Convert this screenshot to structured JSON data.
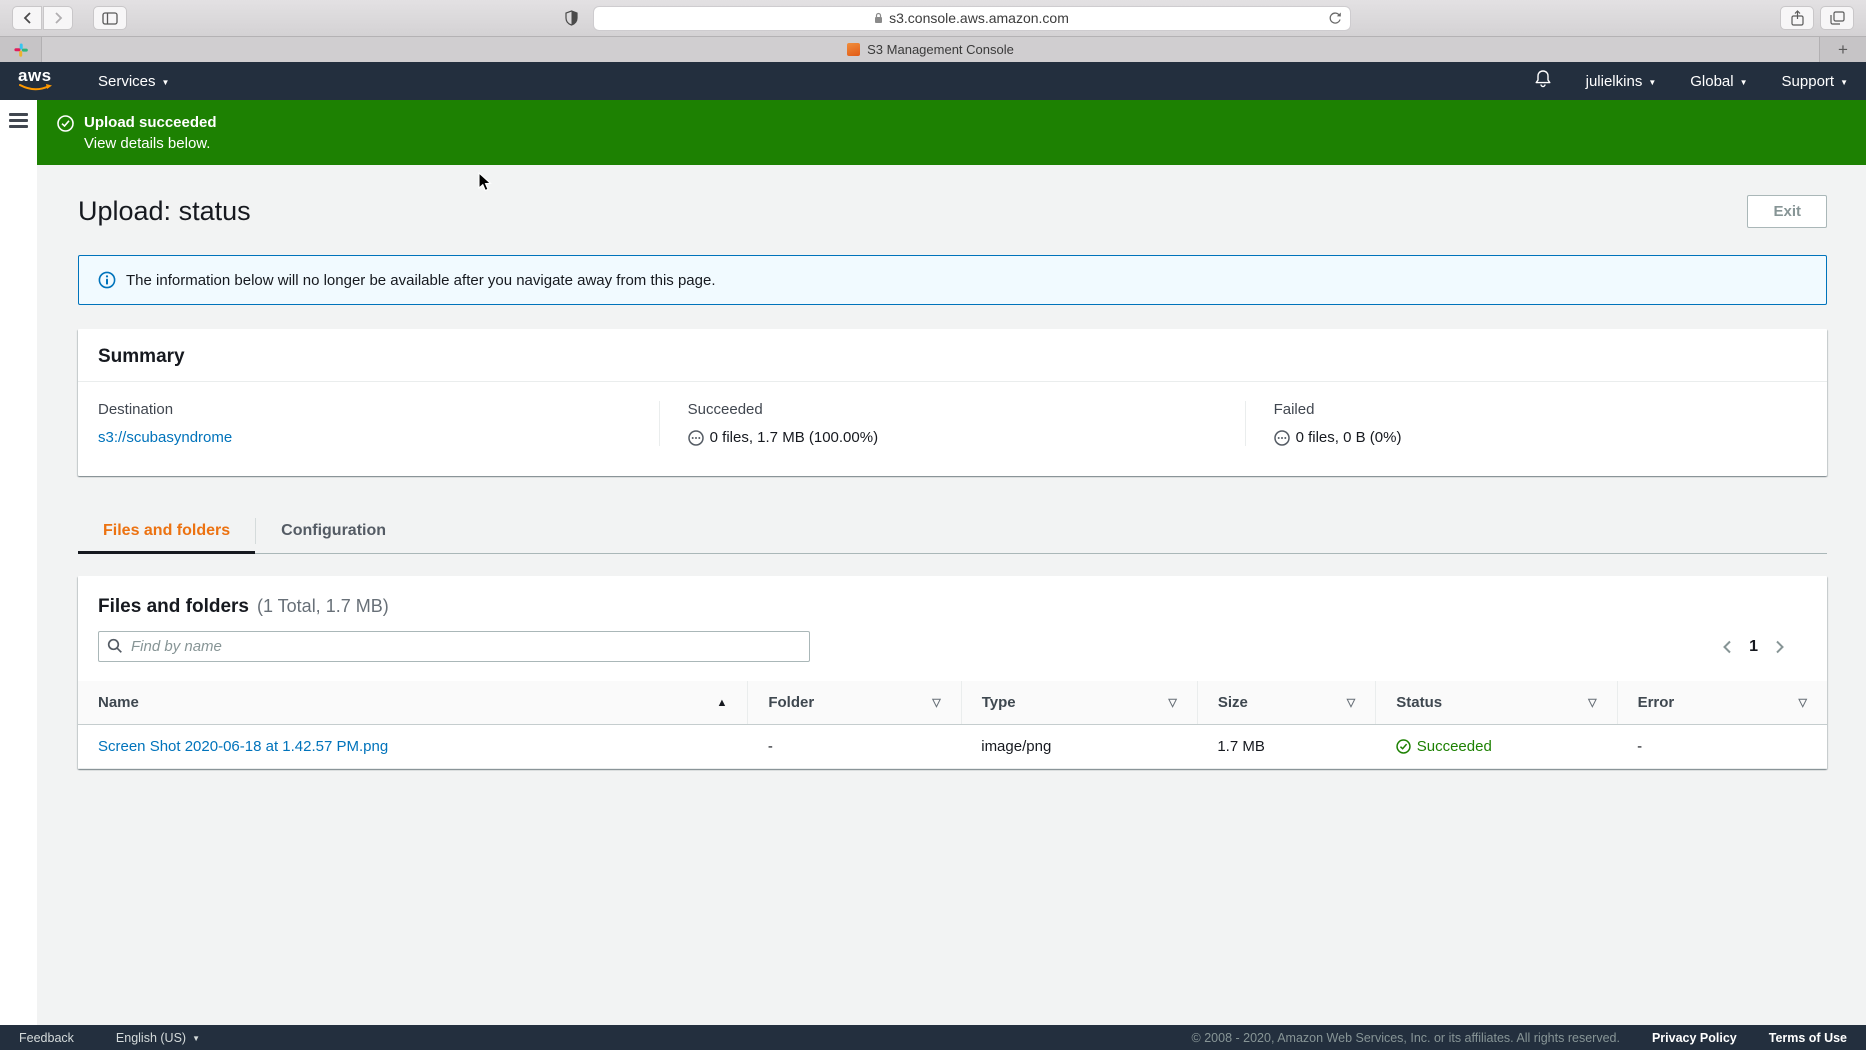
{
  "browser": {
    "url": "s3.console.aws.amazon.com",
    "tab_title": "S3 Management Console",
    "new_tab_label": "+"
  },
  "navbar": {
    "logo_text": "aws",
    "services_label": "Services",
    "username": "julielkins",
    "region_label": "Global",
    "support_label": "Support"
  },
  "banner": {
    "title": "Upload succeeded",
    "subtitle": "View details below."
  },
  "page": {
    "title": "Upload: status",
    "exit_label": "Exit"
  },
  "alert": {
    "text": "The information below will no longer be available after you navigate away from this page."
  },
  "summary": {
    "heading": "Summary",
    "destination": {
      "label": "Destination",
      "value": "s3://scubasyndrome"
    },
    "succeeded": {
      "label": "Succeeded",
      "value": "0 files, 1.7 MB (100.00%)"
    },
    "failed": {
      "label": "Failed",
      "value": "0 files, 0 B (0%)"
    }
  },
  "tabs": {
    "files": "Files and folders",
    "configuration": "Configuration"
  },
  "files_panel": {
    "heading": "Files and folders",
    "count_text": "(1 Total, 1.7 MB)",
    "search_placeholder": "Find by name",
    "page_number": "1",
    "columns": {
      "name": "Name",
      "folder": "Folder",
      "type": "Type",
      "size": "Size",
      "status": "Status",
      "error": "Error"
    },
    "rows": [
      {
        "name": "Screen Shot 2020-06-18 at 1.42.57 PM.png",
        "folder": "-",
        "type": "image/png",
        "size": "1.7 MB",
        "status": "Succeeded",
        "error": "-"
      }
    ]
  },
  "footer": {
    "feedback": "Feedback",
    "language": "English (US)",
    "copyright": "© 2008 - 2020, Amazon Web Services, Inc. or its affiliates. All rights reserved.",
    "privacy": "Privacy Policy",
    "terms": "Terms of Use"
  },
  "colors": {
    "success_green": "#1d8102",
    "link_blue": "#0073bb",
    "active_tab_orange": "#ec7211",
    "navbar_dark": "#232f3e",
    "alert_bg": "#f1faff"
  }
}
